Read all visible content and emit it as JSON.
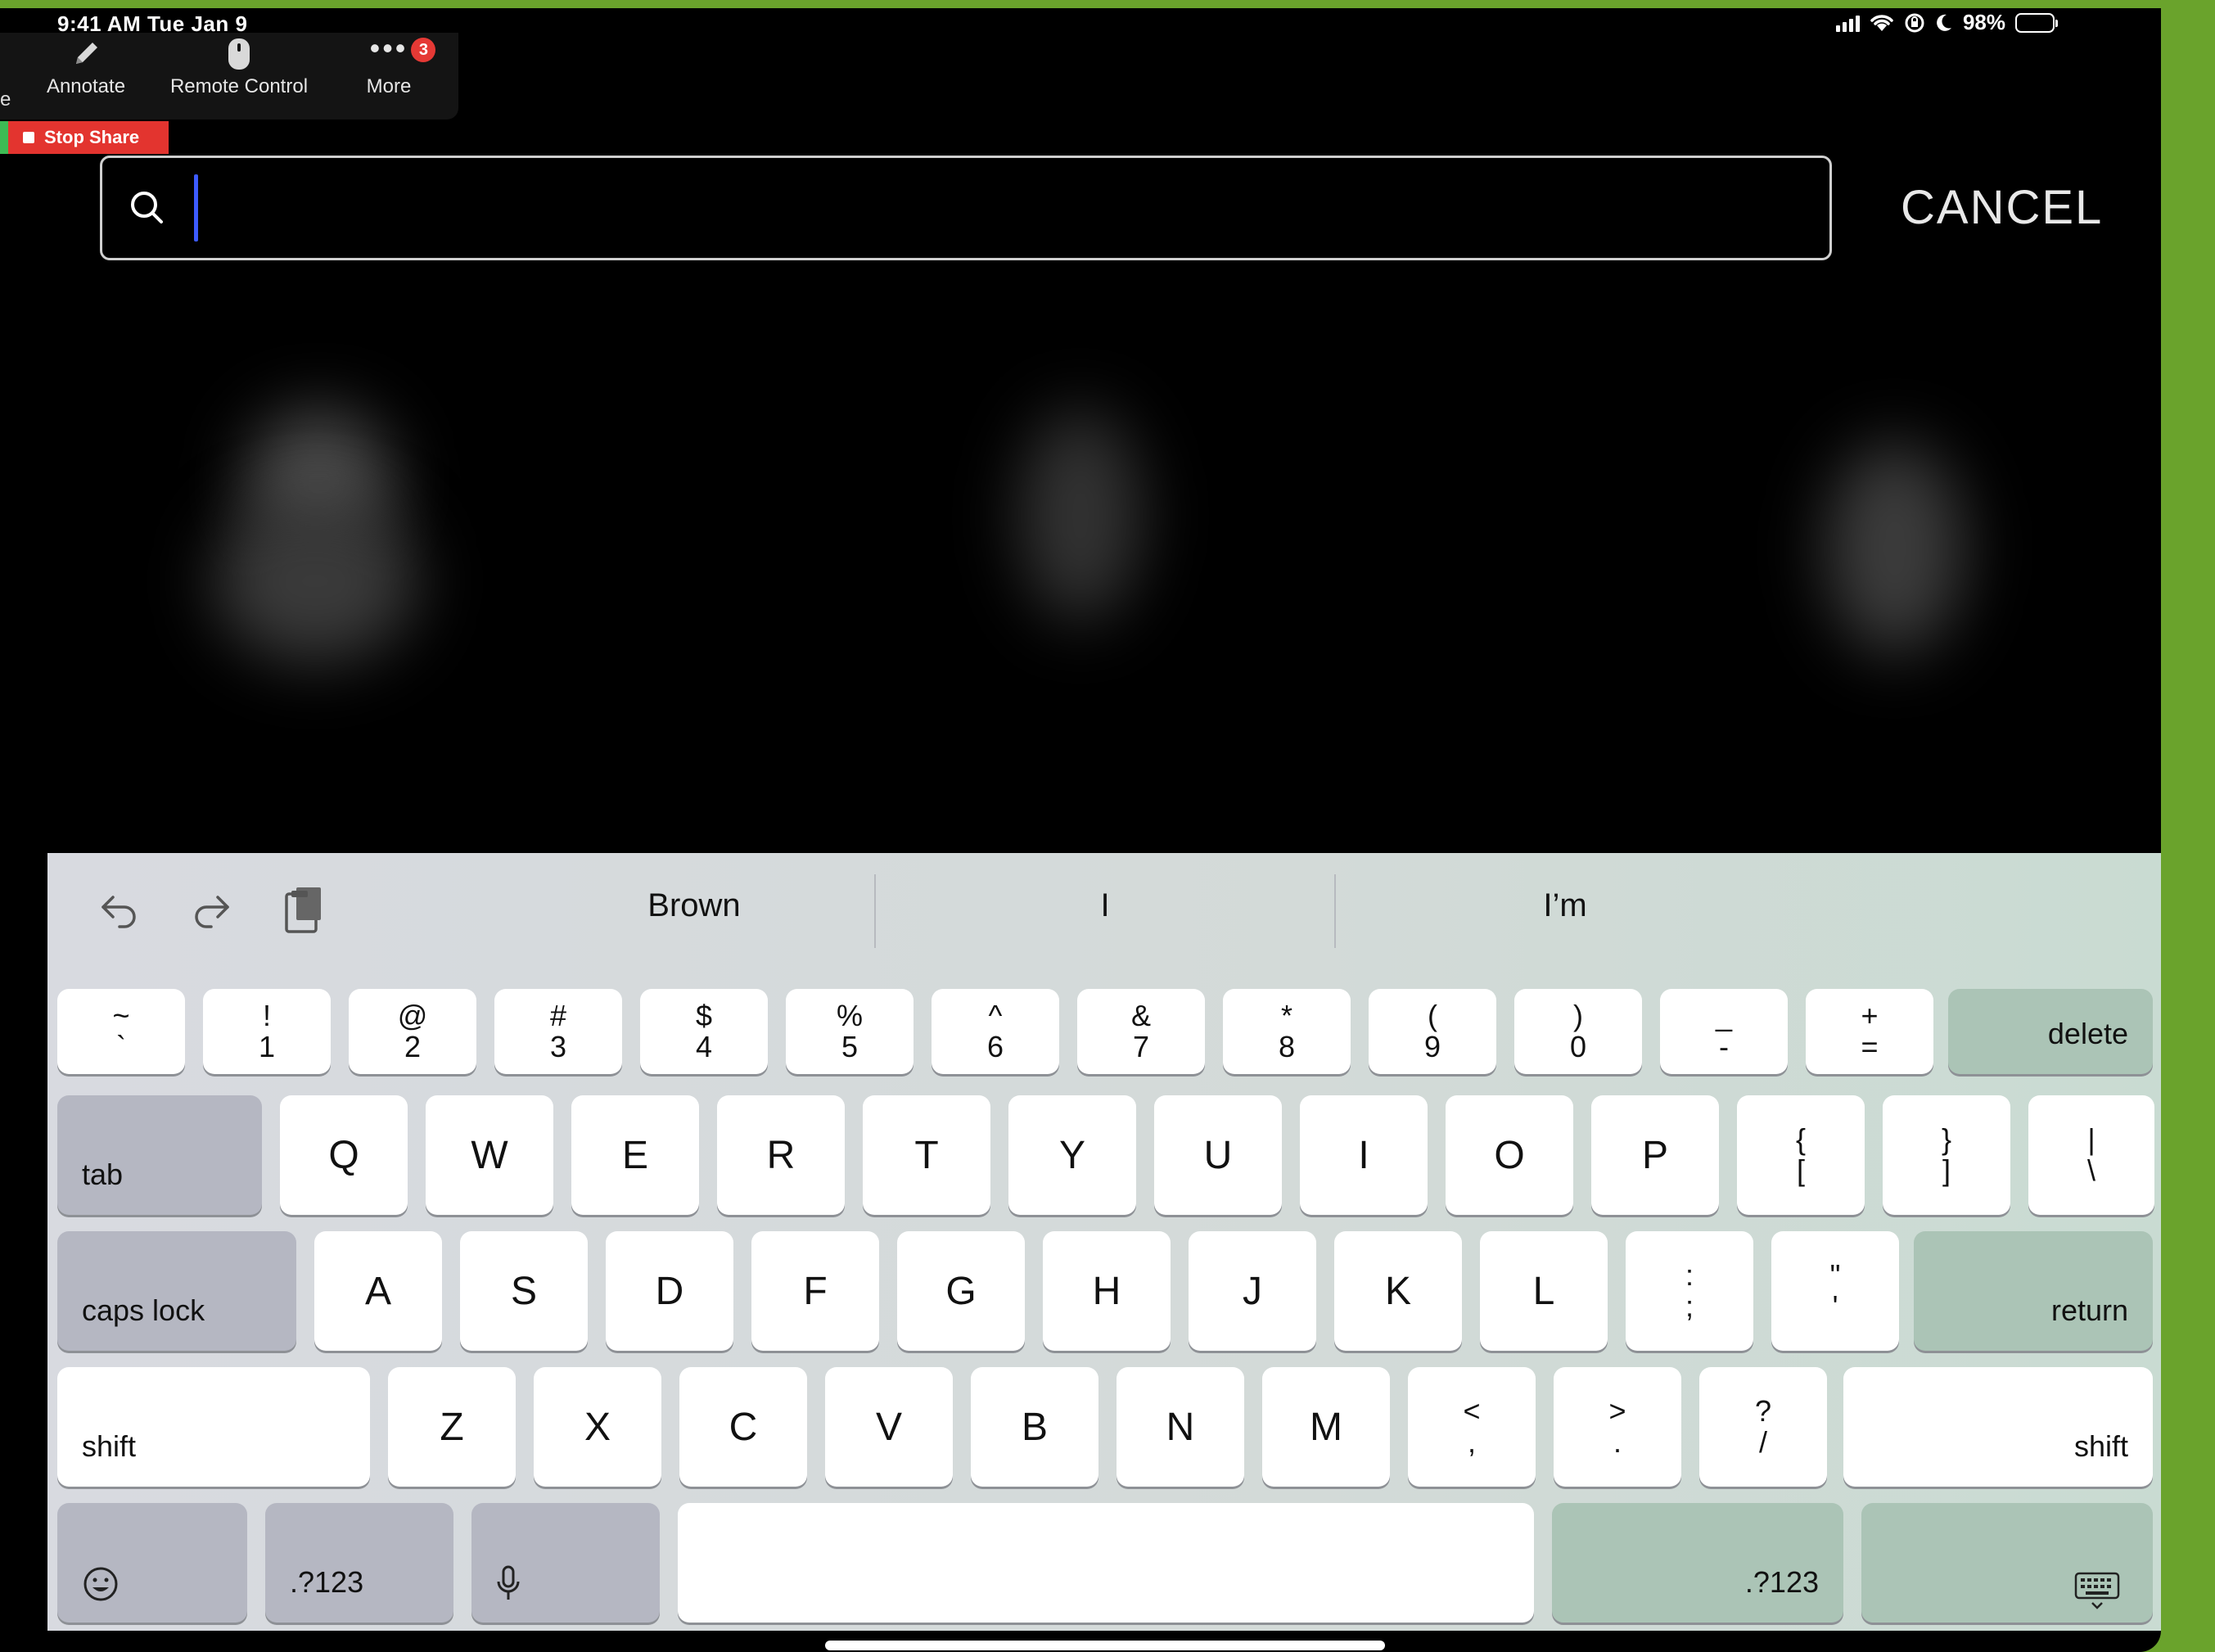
{
  "status_bar": {
    "time": "9:41 AM   Tue Jan 9",
    "battery": "98%"
  },
  "share_toolbar": {
    "edge_label": "e",
    "annotate": "Annotate",
    "remote_control": "Remote Control",
    "more": "More",
    "more_badge": "3",
    "stop_share": "Stop Share"
  },
  "search": {
    "value": "",
    "cancel": "CANCEL"
  },
  "keyboard": {
    "suggestions": [
      "Brown",
      "I",
      "I’m"
    ],
    "row1": [
      {
        "top": "~",
        "bottom": "`"
      },
      {
        "top": "!",
        "bottom": "1"
      },
      {
        "top": "@",
        "bottom": "2"
      },
      {
        "top": "#",
        "bottom": "3"
      },
      {
        "top": "$",
        "bottom": "4"
      },
      {
        "top": "%",
        "bottom": "5"
      },
      {
        "top": "^",
        "bottom": "6"
      },
      {
        "top": "&",
        "bottom": "7"
      },
      {
        "top": "*",
        "bottom": "8"
      },
      {
        "top": "(",
        "bottom": "9"
      },
      {
        "top": ")",
        "bottom": "0"
      },
      {
        "top": "_",
        "bottom": "-"
      },
      {
        "top": "+",
        "bottom": "="
      }
    ],
    "delete": "delete",
    "tab": "tab",
    "row2": [
      "Q",
      "W",
      "E",
      "R",
      "T",
      "Y",
      "U",
      "I",
      "O",
      "P"
    ],
    "row2_sym": [
      {
        "top": "{",
        "bottom": "["
      },
      {
        "top": "}",
        "bottom": "]"
      },
      {
        "top": "|",
        "bottom": "\\"
      }
    ],
    "caps_lock": "caps lock",
    "row3": [
      "A",
      "S",
      "D",
      "F",
      "G",
      "H",
      "J",
      "K",
      "L"
    ],
    "row3_sym": [
      {
        "top": ":",
        "bottom": ";"
      },
      {
        "top": "\"",
        "bottom": "'"
      }
    ],
    "return": "return",
    "shift": "shift",
    "row4": [
      "Z",
      "X",
      "C",
      "V",
      "B",
      "N",
      "M"
    ],
    "row4_sym": [
      {
        "top": "<",
        "bottom": ","
      },
      {
        "top": ">",
        "bottom": "."
      },
      {
        "top": "?",
        "bottom": "/"
      }
    ],
    "numbers_left": ".?123",
    "numbers_right": ".?123"
  }
}
